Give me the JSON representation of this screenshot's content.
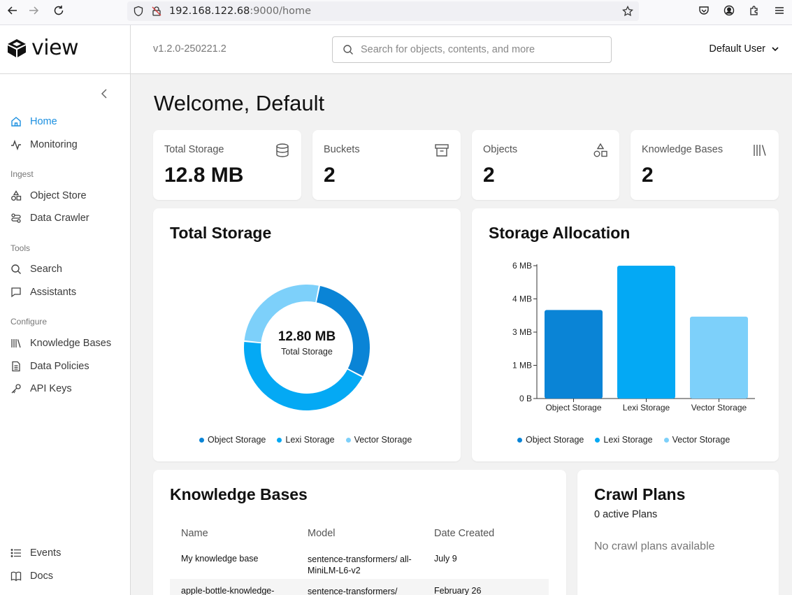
{
  "browser": {
    "url_host": "192.168.122.68",
    "url_rest": ":9000/home"
  },
  "app": {
    "logo_text": "view",
    "version": "v1.2.0-250221.2"
  },
  "search": {
    "placeholder": "Search for objects, contents, and more"
  },
  "user": {
    "name": "Default User"
  },
  "sidebar": {
    "items": [
      {
        "label": "Home",
        "icon": "home-icon",
        "active": true
      },
      {
        "label": "Monitoring",
        "icon": "activity-icon"
      }
    ],
    "sections": [
      {
        "title": "Ingest",
        "items": [
          {
            "label": "Object Store",
            "icon": "shapes-icon"
          },
          {
            "label": "Data Crawler",
            "icon": "crawler-icon"
          }
        ]
      },
      {
        "title": "Tools",
        "items": [
          {
            "label": "Search",
            "icon": "search-icon"
          },
          {
            "label": "Assistants",
            "icon": "chat-icon"
          }
        ]
      },
      {
        "title": "Configure",
        "items": [
          {
            "label": "Knowledge Bases",
            "icon": "library-icon"
          },
          {
            "label": "Data Policies",
            "icon": "document-icon"
          },
          {
            "label": "API Keys",
            "icon": "key-icon"
          }
        ]
      }
    ],
    "bottom": [
      {
        "label": "Events",
        "icon": "list-icon"
      },
      {
        "label": "Docs",
        "icon": "book-icon"
      }
    ]
  },
  "main": {
    "title": "Welcome, Default",
    "stats": [
      {
        "label": "Total Storage",
        "value": "12.8 MB",
        "icon": "database-icon"
      },
      {
        "label": "Buckets",
        "value": "2",
        "icon": "archive-icon"
      },
      {
        "label": "Objects",
        "value": "2",
        "icon": "shapes-icon"
      },
      {
        "label": "Knowledge Bases",
        "value": "2",
        "icon": "library-icon"
      }
    ],
    "total_storage": {
      "title": "Total Storage",
      "center_value": "12.80 MB",
      "center_label": "Total Storage"
    },
    "allocation": {
      "title": "Storage Allocation"
    },
    "legend": [
      {
        "name": "Object Storage",
        "color": "#0a84d6"
      },
      {
        "name": "Lexi Storage",
        "color": "#04a9f4"
      },
      {
        "name": "Vector Storage",
        "color": "#7dd0fa"
      }
    ],
    "knowledge_bases": {
      "title": "Knowledge Bases",
      "columns": [
        "Name",
        "Model",
        "Date Created"
      ],
      "rows": [
        {
          "name": "My knowledge base",
          "model": "sentence-transformers/ all-MiniLM-L6-v2",
          "date": "July 9"
        },
        {
          "name": "apple-bottle-knowledge-",
          "model": "sentence-transformers/",
          "date": "February 26"
        }
      ]
    },
    "crawl_plans": {
      "title": "Crawl Plans",
      "subtitle": "0 active Plans",
      "empty": "No crawl plans available"
    }
  },
  "chart_data": [
    {
      "type": "pie",
      "title": "Total Storage",
      "categories": [
        "Object Storage",
        "Lexi Storage",
        "Vector Storage"
      ],
      "values": [
        3.78,
        5.62,
        3.4
      ],
      "unit": "MB",
      "legend": "bottom",
      "donut": true
    },
    {
      "type": "bar",
      "title": "Storage Allocation",
      "categories": [
        "Object Storage",
        "Lexi Storage",
        "Vector Storage"
      ],
      "values": [
        4.0,
        6.0,
        3.7
      ],
      "yticks": [
        "0 B",
        "1 MB",
        "3 MB",
        "4 MB",
        "6 MB"
      ],
      "ylim": [
        0,
        6
      ],
      "legend": "bottom"
    }
  ]
}
